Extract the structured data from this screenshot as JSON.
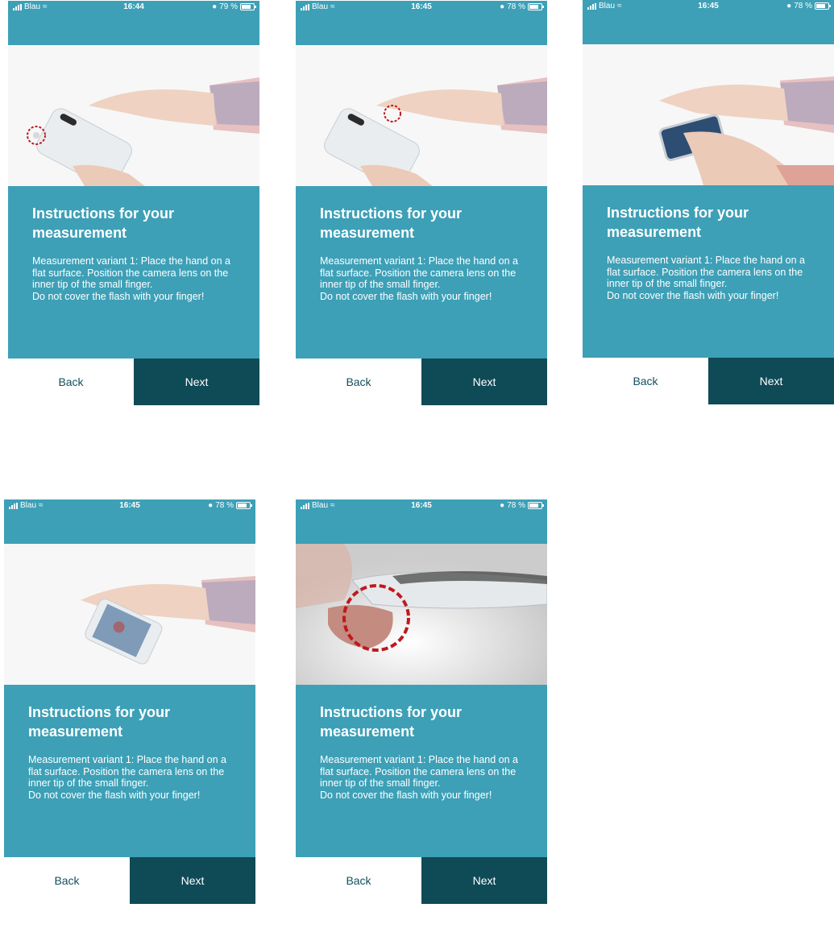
{
  "screens": [
    {
      "status": {
        "carrier": "Blau",
        "time": "16:44",
        "battery": "79 %"
      },
      "title": "Instructions for your measurement",
      "body": "Measurement variant 1: Place the hand on a flat surface. Position the camera lens on the inner tip of the small finger.\nDo not cover the flash with your finger!",
      "back_label": "Back",
      "next_label": "Next"
    },
    {
      "status": {
        "carrier": "Blau",
        "time": "16:45",
        "battery": "78 %"
      },
      "title": "Instructions for your measurement",
      "body": "Measurement variant 1: Place the hand on a flat surface. Position the camera lens on the inner tip of the small finger.\nDo not cover the flash with your finger!",
      "back_label": "Back",
      "next_label": "Next"
    },
    {
      "status": {
        "carrier": "Blau",
        "time": "16:45",
        "battery": "78 %"
      },
      "title": "Instructions for your measurement",
      "body": "Measurement variant 1: Place the hand on a flat surface. Position the camera lens on the inner tip of the small finger.\nDo not cover the flash with your finger!",
      "back_label": "Back",
      "next_label": "Next"
    },
    {
      "status": {
        "carrier": "Blau",
        "time": "16:45",
        "battery": "78 %"
      },
      "title": "Instructions for your measurement",
      "body": "Measurement variant 1: Place the hand on a flat surface. Position the camera lens on the inner tip of the small finger.\nDo not cover the flash with your finger!",
      "back_label": "Back",
      "next_label": "Next"
    },
    {
      "status": {
        "carrier": "Blau",
        "time": "16:45",
        "battery": "78 %"
      },
      "title": "Instructions for your measurement",
      "body": "Measurement variant 1: Place the hand on a flat surface. Position the camera lens on the inner tip of the small finger.\nDo not cover the flash with your finger!",
      "back_label": "Back",
      "next_label": "Next"
    }
  ],
  "colors": {
    "header": "#3da0b7",
    "panel": "#3da0b7",
    "next_button": "#0f4a57",
    "back_text": "#12505d",
    "highlight": "#c0181d"
  }
}
